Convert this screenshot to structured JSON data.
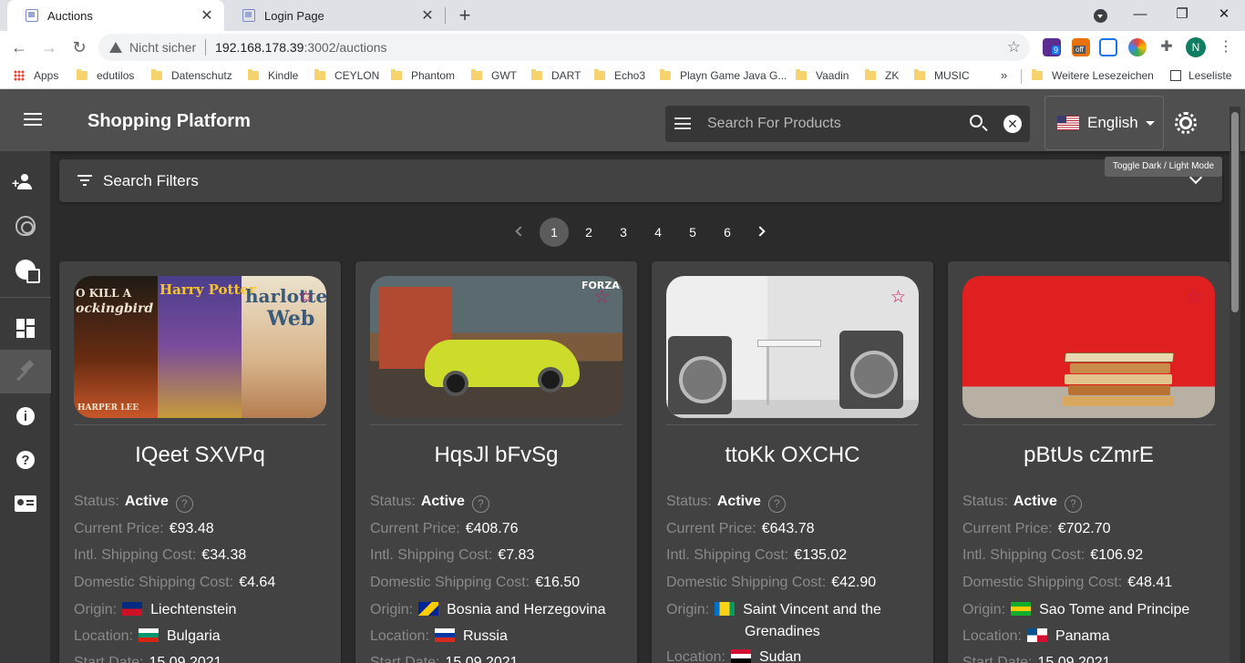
{
  "browser": {
    "tabs": [
      {
        "title": "Auctions",
        "active": true
      },
      {
        "title": "Login Page",
        "active": false
      }
    ],
    "omnibox": {
      "security_text": "Nicht sicher",
      "url_host": "192.168.178.39",
      "url_path": ":3002/auctions"
    },
    "profile_initial": "N",
    "extension_badges": {
      "nine": "9",
      "off": "off"
    },
    "bookmarks": [
      "Apps",
      "edutilos",
      "Datenschutz",
      "Kindle",
      "CEYLON",
      "Phantom",
      "GWT",
      "DART",
      "Echo3",
      "Playn Game Java G...",
      "Vaadin",
      "ZK",
      "MUSIC"
    ],
    "bookmarks_more": "»",
    "other_bookmarks": "Weitere Lesezeichen",
    "reading_list": "Leseliste"
  },
  "app": {
    "title": "Shopping Platform",
    "search_placeholder": "Search For Products",
    "language": "English",
    "mode_tooltip": "Toggle Dark / Light Mode",
    "filters_label": "Search Filters",
    "pagination": {
      "pages": [
        "1",
        "2",
        "3",
        "4",
        "5",
        "6"
      ],
      "current": "1"
    },
    "labels": {
      "status": "Status:",
      "current_price": "Current Price:",
      "intl_shipping": "Intl. Shipping Cost:",
      "domestic_shipping": "Domestic Shipping Cost:",
      "origin": "Origin:",
      "location": "Location:",
      "start_date": "Start Date:"
    },
    "auctions": [
      {
        "title": "IQeet SXVPq",
        "image_text": [
          "O KILL A",
          "ockingbird",
          "Harry Potter",
          "harlotte",
          "Web",
          "HARPER LEE"
        ],
        "status": "Active",
        "current_price": "€93.48",
        "intl_shipping": "€34.38",
        "domestic_shipping": "€4.64",
        "origin": "Liechtenstein",
        "location": "Bulgaria",
        "start_date": "15.09.2021"
      },
      {
        "title": "HqsJl bFvSg",
        "image_text": [
          "FORZA"
        ],
        "status": "Active",
        "current_price": "€408.76",
        "intl_shipping": "€7.83",
        "domestic_shipping": "€16.50",
        "origin": "Bosnia and Herzegovina",
        "location": "Russia",
        "start_date": "15.09.2021"
      },
      {
        "title": "ttoKk OXCHC",
        "image_text": [],
        "status": "Active",
        "current_price": "€643.78",
        "intl_shipping": "€135.02",
        "domestic_shipping": "€42.90",
        "origin": "Saint Vincent and the",
        "origin_line2": "Grenadines",
        "location": "Sudan"
      },
      {
        "title": "pBtUs cZmrE",
        "image_text": [],
        "status": "Active",
        "current_price": "€702.70",
        "intl_shipping": "€106.92",
        "domestic_shipping": "€48.41",
        "origin": "Sao Tome and Principe",
        "location": "Panama",
        "start_date": "15.09.2021"
      }
    ]
  }
}
